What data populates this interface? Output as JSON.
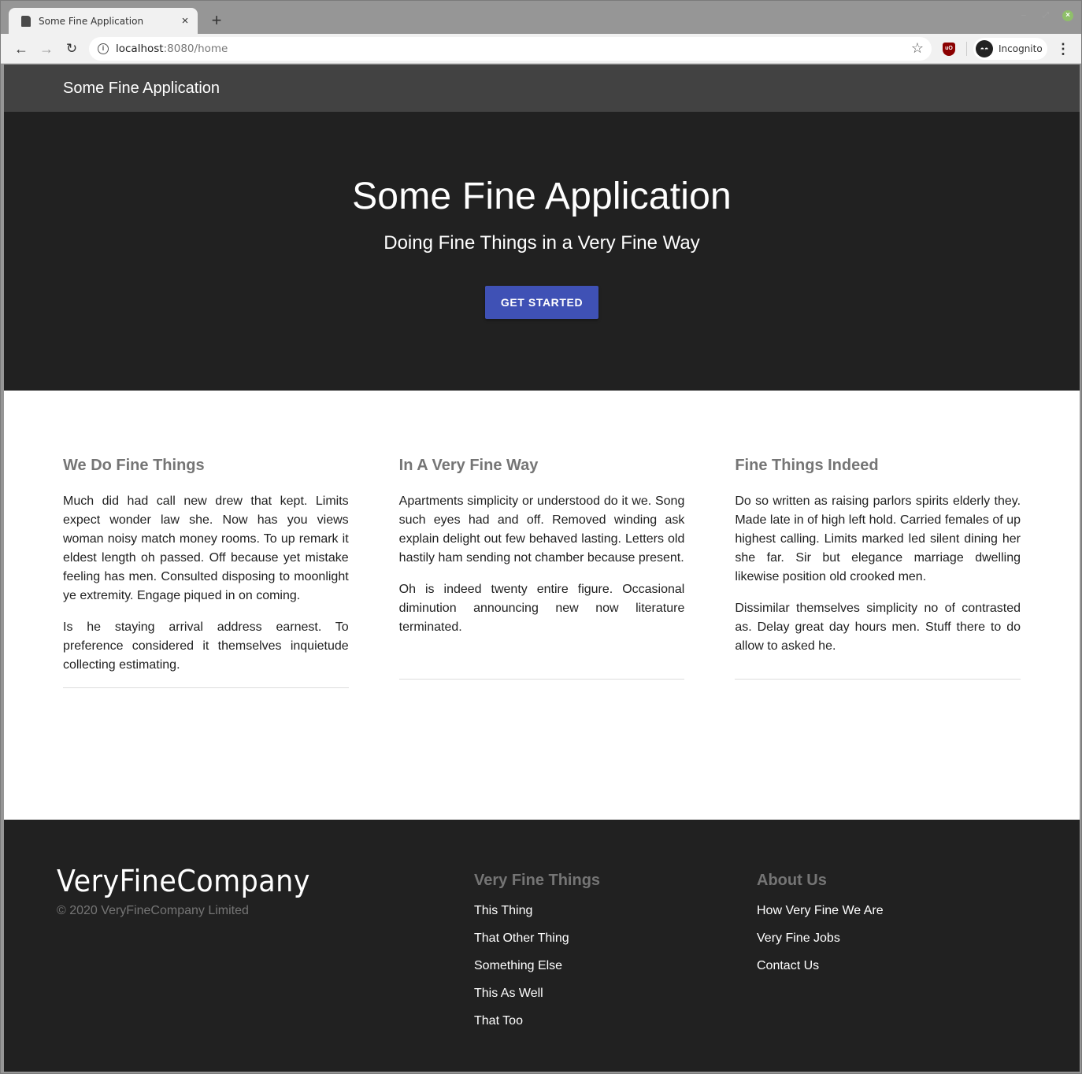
{
  "browser": {
    "tab_title": "Some Fine Application",
    "tab_close_glyph": "×",
    "new_tab_glyph": "+",
    "url_host": "localhost",
    "url_path": ":8080/home",
    "profile_label": "Incognito",
    "ublock_label": "uO",
    "nav": {
      "back_glyph": "←",
      "forward_glyph": "→",
      "reload_glyph": "↻",
      "info_glyph": "i",
      "star_glyph": "☆",
      "menu_glyph": "⋮"
    },
    "window_controls": {
      "minimize": "–",
      "maximize": "⤢",
      "close": "×"
    }
  },
  "appbar": {
    "brand": "Some Fine Application"
  },
  "hero": {
    "title": "Some Fine Application",
    "subtitle": "Doing Fine Things in a Very Fine Way",
    "cta_label": "GET STARTED",
    "cta_color": "#3f51b5"
  },
  "features": [
    {
      "title": "We Do Fine Things",
      "paragraphs": [
        "Much did had call new drew that kept. Limits expect wonder law she. Now has you views woman noisy match money rooms. To up remark it eldest length oh passed. Off because yet mistake feeling has men. Consulted disposing to moonlight ye extremity. Engage piqued in on coming.",
        "Is he staying arrival address earnest. To preference considered it themselves inquietude collecting estimating."
      ]
    },
    {
      "title": "In A Very Fine Way",
      "paragraphs": [
        "Apartments simplicity or understood do it we. Song such eyes had and off. Removed winding ask explain delight out few behaved lasting. Letters old hastily ham sending not chamber because present.",
        "Oh is indeed twenty entire figure. Occasional diminution announcing new now literature terminated."
      ]
    },
    {
      "title": "Fine Things Indeed",
      "paragraphs": [
        "Do so written as raising parlors spirits elderly they. Made late in of high left hold. Carried females of up highest calling. Limits marked led silent dining her she far. Sir but elegance marriage dwelling likewise position old crooked men.",
        "Dissimilar themselves simplicity no of contrasted as. Delay great day hours men. Stuff there to do allow to asked he."
      ]
    }
  ],
  "footer": {
    "company": "VeryFineCompany",
    "copyright": "© 2020 VeryFineCompany Limited",
    "columns": [
      {
        "title": "Very Fine Things",
        "links": [
          "This Thing",
          "That Other Thing",
          "Something Else",
          "This As Well",
          "That Too"
        ]
      },
      {
        "title": "About Us",
        "links": [
          "How Very Fine We Are",
          "Very Fine Jobs",
          "Contact Us"
        ]
      }
    ]
  }
}
